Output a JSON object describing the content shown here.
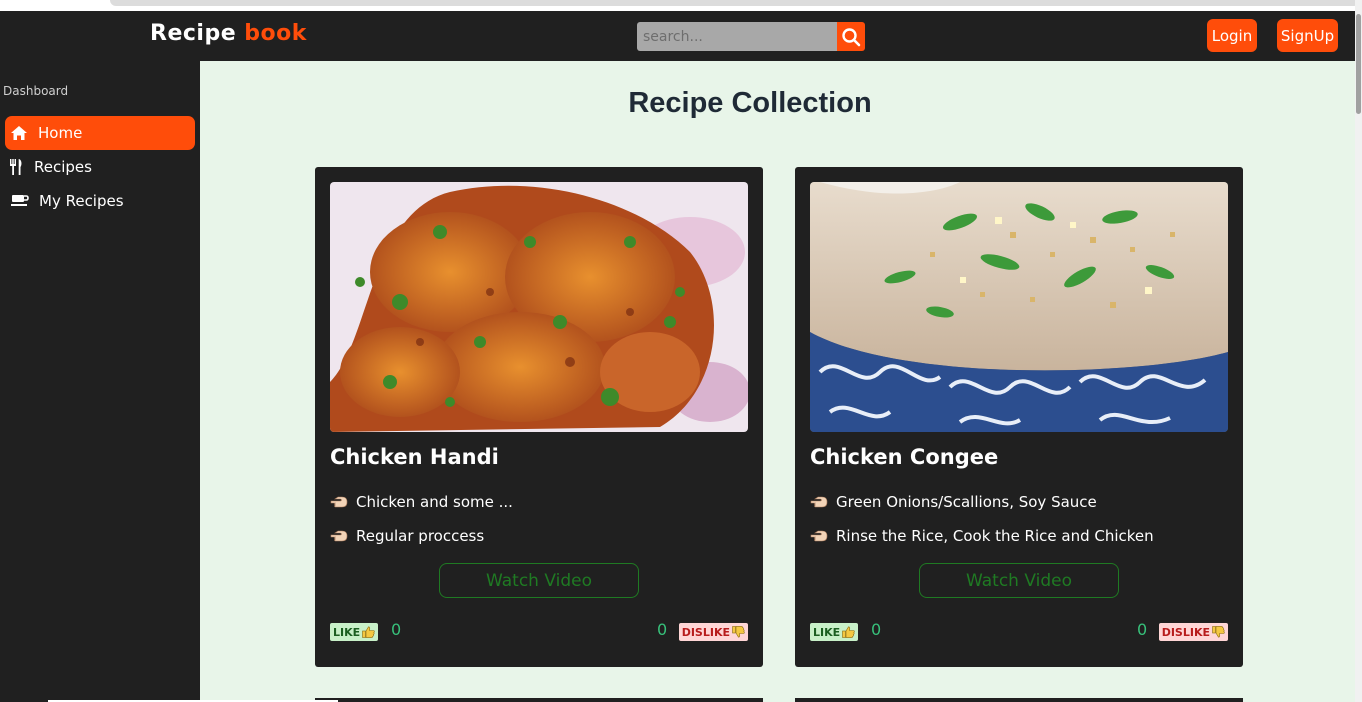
{
  "app": {
    "brand_main": "Recipe",
    "brand_accent": "book"
  },
  "header": {
    "search_placeholder": "search...",
    "login_label": "Login",
    "signup_label": "SignUp"
  },
  "sidebar": {
    "heading": "Dashboard",
    "items": [
      {
        "label": "Home",
        "icon": "home-icon",
        "active": true
      },
      {
        "label": "Recipes",
        "icon": "utensils-icon",
        "active": false
      },
      {
        "label": "My Recipes",
        "icon": "coffee-icon",
        "active": false
      }
    ]
  },
  "main": {
    "title": "Recipe Collection",
    "cards": [
      {
        "title": "Chicken Handi",
        "ingredients": "Chicken and some ...",
        "instructions": "Regular proccess",
        "watch_label": "Watch Video",
        "like_label": "LIKE",
        "like_count": "0",
        "dislike_label": "DISLIKE",
        "dislike_count": "0"
      },
      {
        "title": "Chicken Congee",
        "ingredients": "Green Onions/Scallions, Soy Sauce",
        "instructions": "Rinse the Rice, Cook the Rice and Chicken",
        "watch_label": "Watch Video",
        "like_label": "LIKE",
        "like_count": "0",
        "dislike_label": "DISLIKE",
        "dislike_count": "0"
      }
    ]
  },
  "colors": {
    "accent": "#ff4d0a",
    "dark": "#202020",
    "main_bg": "#e8f5e9",
    "watch_green": "#1f7a23",
    "count_green": "#37c07a"
  }
}
